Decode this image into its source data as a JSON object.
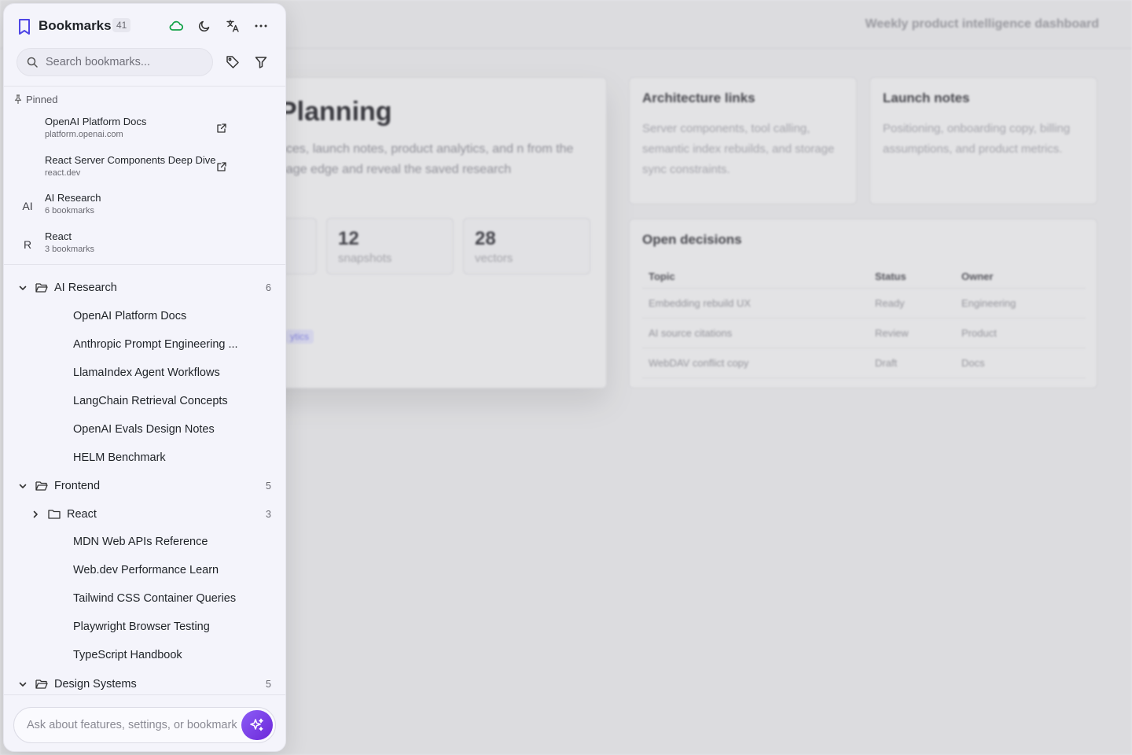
{
  "background": {
    "subtitle": "Weekly product intelligence dashboard",
    "hero": {
      "title": "Planning",
      "text": "nces, launch notes, product analytics, and n from the page edge and reveal the saved research",
      "stats": [
        {
          "num": "",
          "label": ""
        },
        {
          "num": "12",
          "label": "snapshots"
        },
        {
          "num": "28",
          "label": "vectors"
        }
      ],
      "tag": "ytics"
    },
    "arch": {
      "title": "Architecture links",
      "text": "Server components, tool calling, semantic index rebuilds, and storage sync constraints."
    },
    "launch": {
      "title": "Launch notes",
      "text": "Positioning, onboarding copy, billing assumptions, and product metrics."
    },
    "decisions": {
      "title": "Open decisions",
      "headers": [
        "Topic",
        "Status",
        "Owner"
      ],
      "rows": [
        [
          "Embedding rebuild UX",
          "Ready",
          "Engineering"
        ],
        [
          "AI source citations",
          "Review",
          "Product"
        ],
        [
          "WebDAV conflict copy",
          "Draft",
          "Docs"
        ]
      ]
    }
  },
  "sidebar": {
    "title": "Bookmarks",
    "count": "41",
    "header_icons": [
      "cloud-sync-icon",
      "moon-icon",
      "translate-icon",
      "more-icon"
    ],
    "search_placeholder": "Search bookmarks...",
    "pinned_label": "Pinned",
    "pinned": [
      {
        "title": "OpenAI Platform Docs",
        "sub": "platform.openai.com",
        "badge": "",
        "external": true
      },
      {
        "title": "React Server Components Deep Dive",
        "sub": "react.dev",
        "badge": "",
        "external": true
      },
      {
        "title": "AI Research",
        "sub": "6 bookmarks",
        "badge": "AI",
        "external": false
      },
      {
        "title": "React",
        "sub": "3 bookmarks",
        "badge": "R",
        "external": false
      }
    ],
    "tree": [
      {
        "type": "folder",
        "label": "AI Research",
        "count": "6",
        "expanded": true,
        "depth": 0
      },
      {
        "type": "leaf",
        "label": "OpenAI Platform Docs"
      },
      {
        "type": "leaf",
        "label": "Anthropic Prompt Engineering ..."
      },
      {
        "type": "leaf",
        "label": "LlamaIndex Agent Workflows"
      },
      {
        "type": "leaf",
        "label": "LangChain Retrieval Concepts"
      },
      {
        "type": "leaf",
        "label": "OpenAI Evals Design Notes"
      },
      {
        "type": "leaf",
        "label": "HELM Benchmark"
      },
      {
        "type": "folder",
        "label": "Frontend",
        "count": "5",
        "expanded": true,
        "depth": 0
      },
      {
        "type": "folder",
        "label": "React",
        "count": "3",
        "expanded": false,
        "depth": 1
      },
      {
        "type": "leaf",
        "label": "MDN Web APIs Reference"
      },
      {
        "type": "leaf",
        "label": "Web.dev Performance Learn"
      },
      {
        "type": "leaf",
        "label": "Tailwind CSS Container Queries"
      },
      {
        "type": "leaf",
        "label": "Playwright Browser Testing"
      },
      {
        "type": "leaf",
        "label": "TypeScript Handbook"
      },
      {
        "type": "folder",
        "label": "Design Systems",
        "count": "5",
        "expanded": true,
        "depth": 0
      }
    ],
    "ask_placeholder": "Ask about features, settings, or bookmarks",
    "colors": {
      "accent": "#4f46e5",
      "cloud": "#16a34a",
      "spark": "#7c3aed"
    }
  }
}
